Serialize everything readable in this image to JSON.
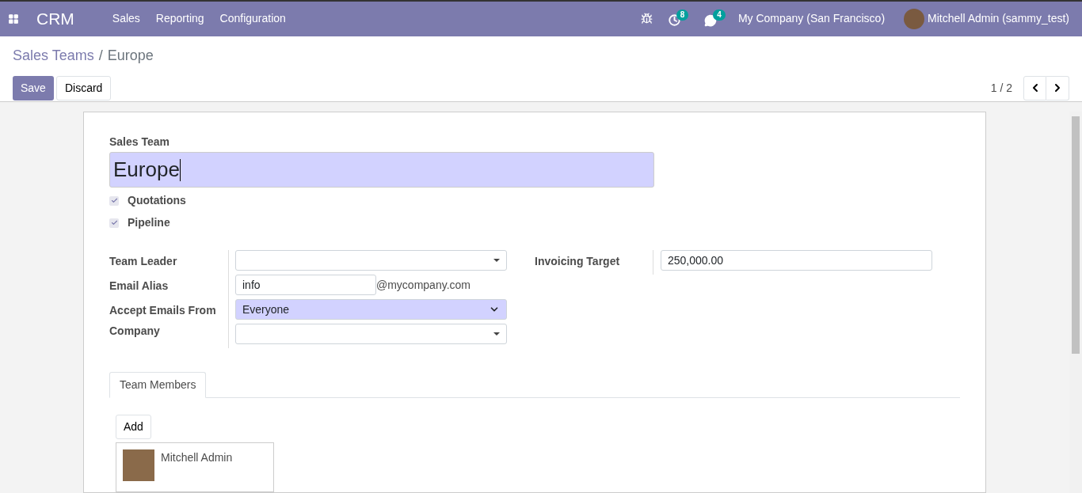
{
  "navbar": {
    "app_name": "CRM",
    "menu": [
      "Sales",
      "Reporting",
      "Configuration"
    ],
    "activity_count": "8",
    "message_count": "4",
    "company": "My Company (San Francisco)",
    "user": "Mitchell Admin (sammy_test)"
  },
  "breadcrumb": {
    "parent": "Sales Teams",
    "separator": "/",
    "current": "Europe"
  },
  "buttons": {
    "save": "Save",
    "discard": "Discard"
  },
  "pager": {
    "value": "1 / 2"
  },
  "form": {
    "name_label": "Sales Team",
    "name": "Europe",
    "options": [
      {
        "label": "Quotations",
        "checked": true
      },
      {
        "label": "Pipeline",
        "checked": true
      }
    ],
    "left_fields": [
      {
        "kind": "many2one",
        "label": "Team Leader"
      },
      {
        "kind": "alias",
        "label": "Email Alias",
        "value": "info",
        "suffix": "@mycompany.com"
      },
      {
        "kind": "select",
        "label": "Accept Emails From",
        "value": "Everyone"
      },
      {
        "kind": "many2one",
        "label": "Company"
      }
    ],
    "right_fields": [
      {
        "kind": "text",
        "label": "Invoicing Target",
        "value": "250,000.00"
      }
    ],
    "tabs": [
      {
        "label": "Team Members",
        "selected": true
      }
    ],
    "add_button": "Add",
    "members": [
      {
        "name": "Mitchell Admin"
      }
    ]
  }
}
